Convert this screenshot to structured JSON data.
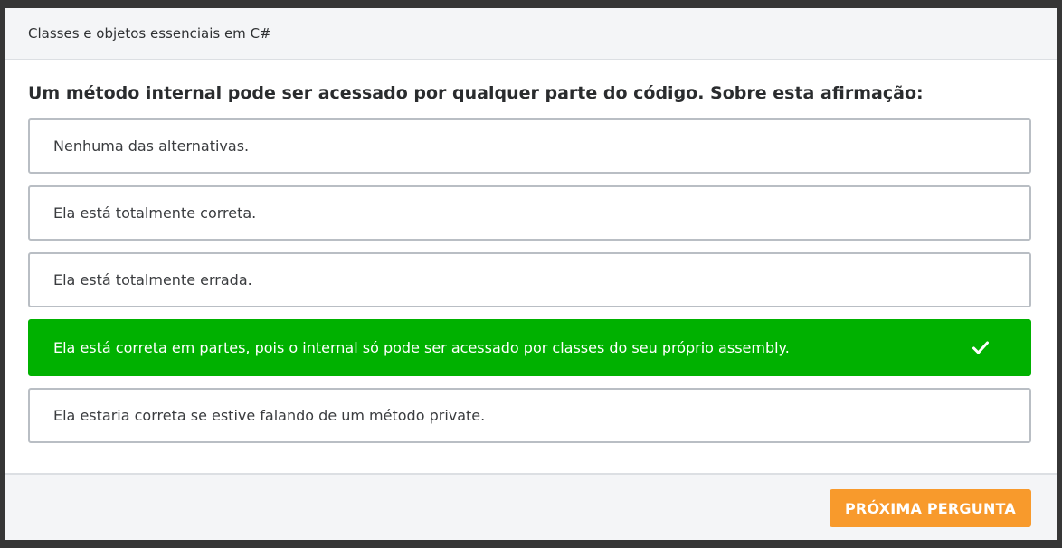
{
  "modal": {
    "title": "Classes e objetos essenciais em C#"
  },
  "question": {
    "text": "Um método internal pode ser acessado por qualquer parte do código. Sobre esta afirmação:"
  },
  "options": [
    {
      "label": "Nenhuma das alternativas.",
      "state": "default"
    },
    {
      "label": "Ela está totalmente correta.",
      "state": "default"
    },
    {
      "label": "Ela está totalmente errada.",
      "state": "default"
    },
    {
      "label": "Ela está correta em partes, pois o internal só pode ser acessado por classes do seu próprio assembly.",
      "state": "correct",
      "icon": "check-icon"
    },
    {
      "label": "Ela estaria correta se estive falando de um método private.",
      "state": "default"
    }
  ],
  "footer": {
    "next_label": "PRÓXIMA PERGUNTA"
  },
  "colors": {
    "correct": "#00b100",
    "accent": "#f89a2c",
    "border": "#b9bec4",
    "backdrop": "#363636"
  }
}
